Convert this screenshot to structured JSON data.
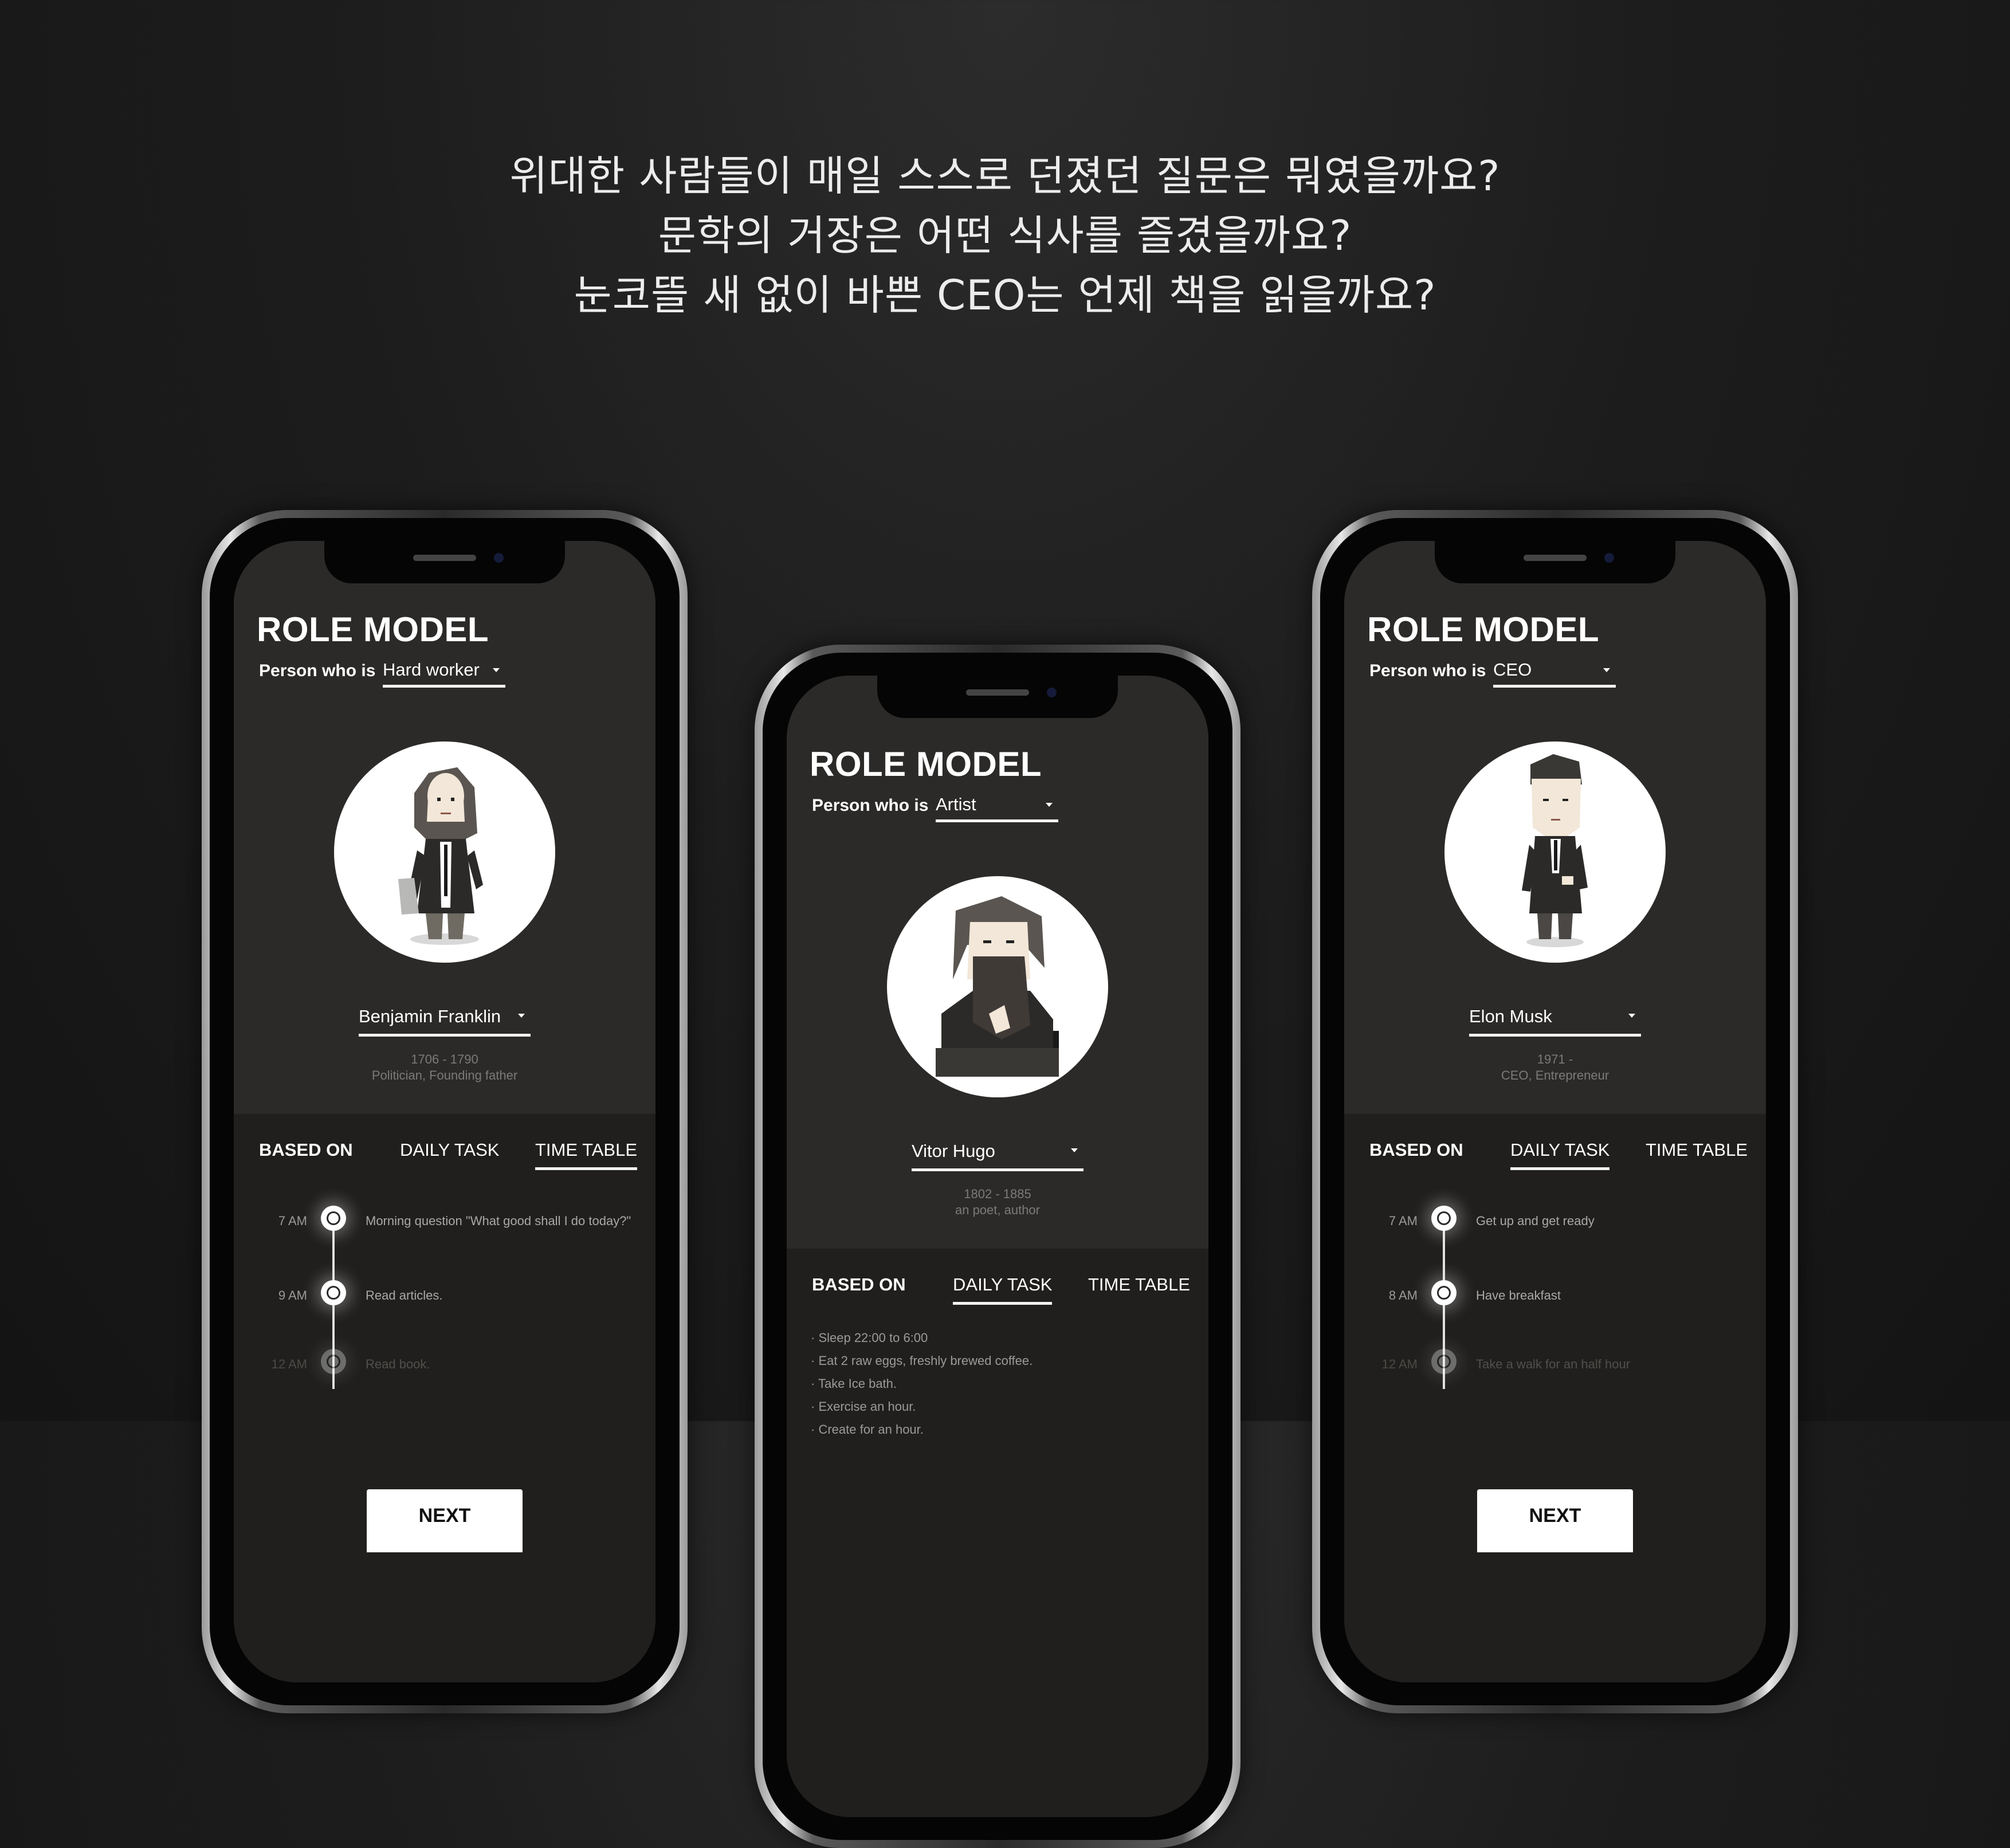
{
  "headline": {
    "line1": "위대한 사람들이 매일 스스로 던졌던 질문은 뭐였을까요?",
    "line2": "문학의 거장은 어떤 식사를 즐겼을까요?",
    "line3": "눈코뜰 새 없이 바쁜 CEO는 언제 책을 읽을까요?"
  },
  "phones": [
    {
      "title": "ROLE MODEL",
      "person_label": "Person who is",
      "category": "Hard worker",
      "name": "Benjamin Franklin",
      "years": "1706 - 1790",
      "role": "Politician, Founding father",
      "tabs": {
        "based_on": "BASED ON",
        "daily_task": "DAILY TASK",
        "time_table": "TIME TABLE",
        "active": "time_table"
      },
      "timeline": [
        {
          "time": "7 AM",
          "text": "Morning question \"What good shall I do today?\""
        },
        {
          "time": "9 AM",
          "text": "Read articles."
        },
        {
          "time": "12 AM",
          "text": "Read book."
        }
      ],
      "next_label": "NEXT"
    },
    {
      "title": "ROLE MODEL",
      "person_label": "Person who is",
      "category": "Artist",
      "name": "Vitor Hugo",
      "years": "1802 - 1885",
      "role": "an poet, author",
      "tabs": {
        "based_on": "BASED ON",
        "daily_task": "DAILY TASK",
        "time_table": "TIME TABLE",
        "active": "daily_task"
      },
      "tasks": [
        "· Sleep 22:00 to 6:00",
        "· Eat 2 raw eggs, freshly brewed coffee.",
        "· Take Ice bath.",
        "· Exercise an hour.",
        "· Create for an hour."
      ]
    },
    {
      "title": "ROLE MODEL",
      "person_label": "Person who is",
      "category": "CEO",
      "name": "Elon Musk",
      "years": "1971 -",
      "role": "CEO, Entrepreneur",
      "tabs": {
        "based_on": "BASED ON",
        "daily_task": "DAILY TASK",
        "time_table": "TIME TABLE",
        "active": "daily_task"
      },
      "timeline": [
        {
          "time": "7 AM",
          "text": "Get up and get ready"
        },
        {
          "time": "8 AM",
          "text": "Have breakfast"
        },
        {
          "time": "12 AM",
          "text": "Take a walk for an half hour"
        }
      ],
      "next_label": "NEXT"
    }
  ],
  "colors": {
    "screen_bg": "#2b2a28",
    "screen_bottom_bg": "#201f1d",
    "text": "#ffffff",
    "muted": "#7a7a78"
  }
}
